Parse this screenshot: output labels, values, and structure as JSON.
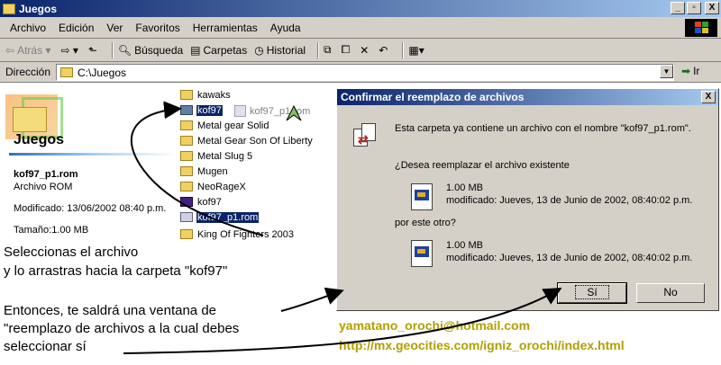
{
  "window": {
    "title": "Juegos"
  },
  "titlebar_buttons": [
    "_",
    "▫",
    "X"
  ],
  "menu": [
    "Archivo",
    "Edición",
    "Ver",
    "Favoritos",
    "Herramientas",
    "Ayuda"
  ],
  "toolbar": {
    "back": "Atrás",
    "search": "Búsqueda",
    "folders": "Carpetas",
    "history": "Historial"
  },
  "address": {
    "label": "Dirección",
    "value": "C:\\Juegos",
    "go": "Ir"
  },
  "left_pane": {
    "folder_title": "Juegos",
    "file_name": "kof97_p1.rom",
    "file_type": "Archivo ROM",
    "modified": "Modificado: 13/06/2002 08:40 p.m.",
    "size": "Tamaño:1.00 MB"
  },
  "files": [
    {
      "name": "kawaks",
      "kind": "folder"
    },
    {
      "name": "kof97",
      "kind": "folder-selected"
    },
    {
      "name": "Metal gear Solid",
      "kind": "folder"
    },
    {
      "name": "Metal Gear Son Of Liberty",
      "kind": "folder"
    },
    {
      "name": "Metal Slug 5",
      "kind": "folder"
    },
    {
      "name": "Mugen",
      "kind": "folder"
    },
    {
      "name": "NeoRageX",
      "kind": "folder"
    },
    {
      "name": "kof97",
      "kind": "app"
    },
    {
      "name": "kof97_p1.rom",
      "kind": "rom-selected"
    },
    {
      "name": "King Of Fighters 2003",
      "kind": "folder"
    }
  ],
  "drag_ghost": "kof97_p1.rom",
  "dialog": {
    "title": "Confirmar el reemplazo de archivos",
    "close": "X",
    "message": "Esta carpeta ya contiene un archivo con el nombre \"kof97_p1.rom\".",
    "question": "¿Desea reemplazar el archivo existente",
    "existing_size": "1.00 MB",
    "existing_modified": "modificado: Jueves, 13 de Junio de 2002, 08:40:02 p.m.",
    "with_this": "por este otro?",
    "new_size": "1.00 MB",
    "new_modified": "modificado: Jueves, 13 de Junio de 2002, 08:40:02 p.m.",
    "yes": "Sí",
    "no": "No"
  },
  "overlay": {
    "line1": "Seleccionas el archivo",
    "line2": "y lo arrastras hacia la carpeta \"kof97\"",
    "line3": "Entonces, te saldrá una ventana de",
    "line4": "\"reemplazo de archivos a la cual debes",
    "line5": "seleccionar sí",
    "email": "yamatano_orochi@hotmail.com",
    "url": "http://mx.geocities.com/igniz_orochi/index.html"
  }
}
